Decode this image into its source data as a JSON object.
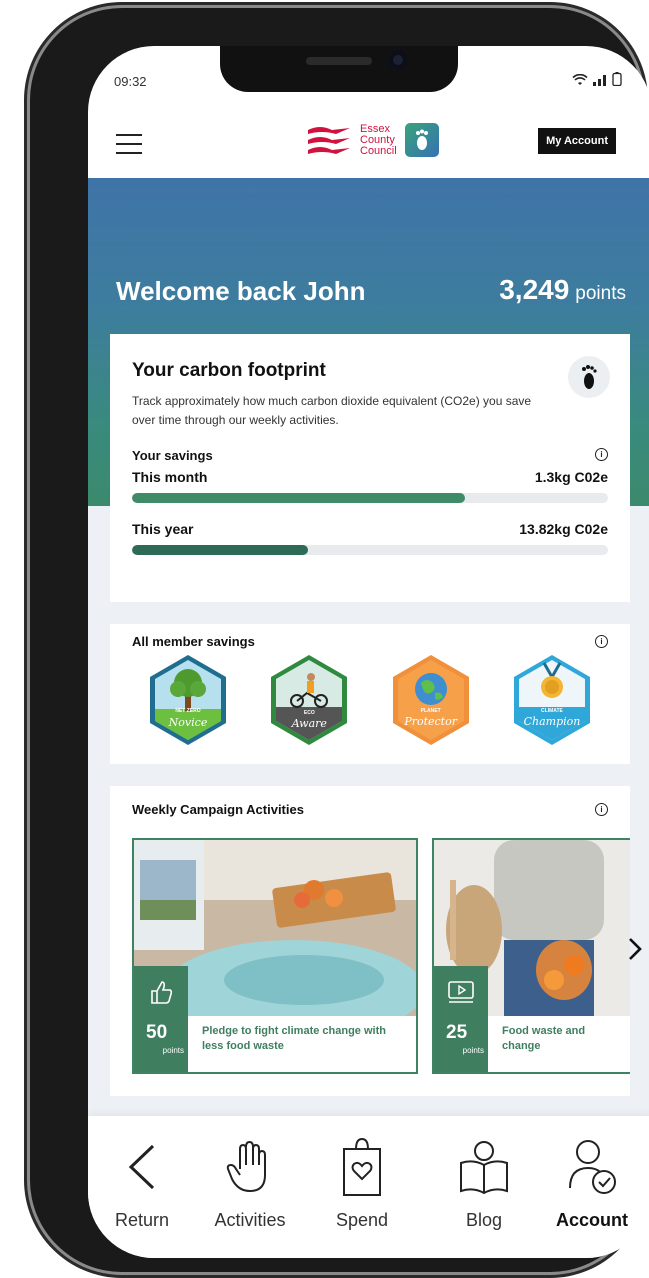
{
  "status": {
    "time": "09:32"
  },
  "header": {
    "logo_lines": [
      "Essex",
      "County",
      "Council"
    ],
    "my_account_label": "My Account"
  },
  "hero": {
    "welcome": "Welcome back John",
    "points_value": "3,249",
    "points_label": "points"
  },
  "carbon": {
    "title": "Your carbon footprint",
    "description": "Track approximately how much carbon dioxide equivalent (CO2e) you save over time through our weekly activities.",
    "savings_label": "Your savings",
    "rows": [
      {
        "label": "This month",
        "value": "1.3kg C02e",
        "progress": 0.7,
        "color": "#3f8a67"
      },
      {
        "label": "This year",
        "value": "13.82kg C02e",
        "progress": 0.37,
        "color": "#2e6b56"
      }
    ]
  },
  "members": {
    "title": "All member savings",
    "badges": [
      {
        "top": "NET ZERO",
        "name": "Novice",
        "color": "#6cbf3f"
      },
      {
        "top": "ECO",
        "name": "Aware",
        "color": "#3f9a4d"
      },
      {
        "top": "PLANET",
        "name": "Protector",
        "color": "#f0903a"
      },
      {
        "top": "CLIMATE",
        "name": "Champion",
        "color": "#2fa7d8"
      }
    ]
  },
  "weekly": {
    "title": "Weekly Campaign Activities",
    "activities": [
      {
        "points": "50",
        "points_label": "points",
        "text": "Pledge to fight climate change with less food waste",
        "icon": "thumbs-up-icon"
      },
      {
        "points": "25",
        "points_label": "points",
        "text": "Food waste and change",
        "icon": "video-icon"
      }
    ]
  },
  "nav": {
    "items": [
      {
        "label": "Return",
        "icon": "back-icon"
      },
      {
        "label": "Activities",
        "icon": "hand-icon"
      },
      {
        "label": "Spend",
        "icon": "shopping-bag-icon"
      },
      {
        "label": "Blog",
        "icon": "book-icon"
      },
      {
        "label": "Account",
        "icon": "account-icon",
        "active": true
      }
    ]
  }
}
